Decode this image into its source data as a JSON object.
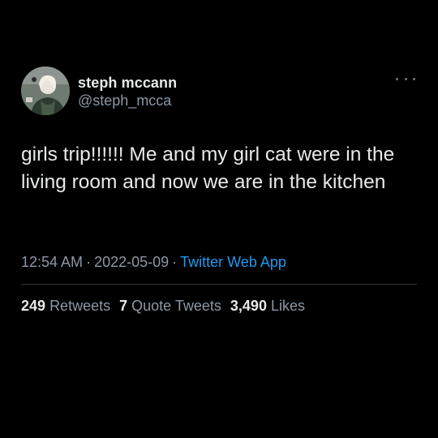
{
  "author": {
    "display_name": "steph mccann",
    "handle": "@steph_mcca"
  },
  "tweet": {
    "text": "girls trip!!!!!! Me and my girl cat were in the living room and now we are in the kitchen",
    "time": "12:54 AM",
    "separator": "·",
    "date": "2022-05-09",
    "source": "Twitter Web App"
  },
  "stats": {
    "retweets_count": "249",
    "retweets_label": "Retweets",
    "quotes_count": "7",
    "quotes_label": "Quote Tweets",
    "likes_count": "3,490",
    "likes_label": "Likes"
  },
  "icons": {
    "more": "more-horizontal-icon"
  },
  "colors": {
    "background": "#000000",
    "primary_text": "#e7e9ea",
    "secondary_text": "#8b98a5",
    "link": "#1d9bf0",
    "divider": "#2f3336"
  }
}
